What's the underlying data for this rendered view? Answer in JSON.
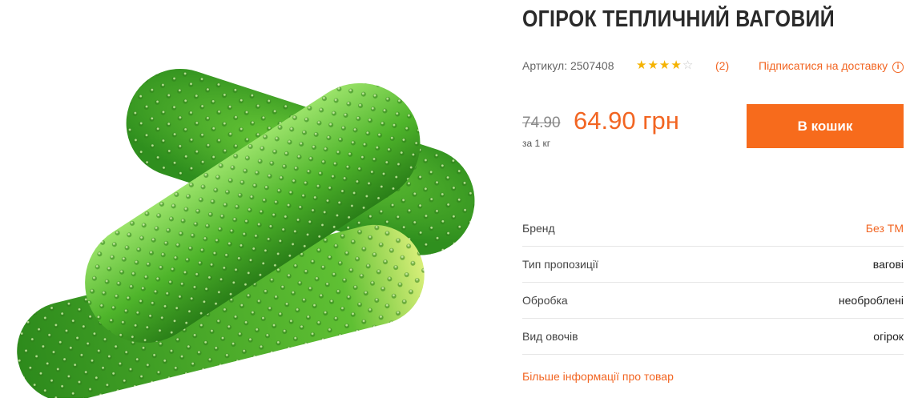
{
  "product": {
    "title": "ОГІРОК ТЕПЛИЧНИЙ ВАГОВИЙ",
    "sku": "Артикул: 2507408",
    "rating": 4,
    "rating_max": 5,
    "rating_count": "(2)",
    "subscribe_label": "Підписатися на доставку",
    "image_icon": "cucumber-image"
  },
  "price": {
    "old": "74.90",
    "current": "64.90 грн",
    "unit": "за 1 кг"
  },
  "cart": {
    "label": "В кошик"
  },
  "specs": [
    {
      "label": "Бренд",
      "value": "Без ТМ"
    },
    {
      "label": "Тип пропозиції",
      "value": "вагові"
    },
    {
      "label": "Обробка",
      "value": "необроблені"
    },
    {
      "label": "Вид овочів",
      "value": "огірок"
    }
  ],
  "more_info": "Більше інформації про товар",
  "colors": {
    "accent": "#f76b1c",
    "link": "#f26522",
    "star": "#f5b301"
  }
}
